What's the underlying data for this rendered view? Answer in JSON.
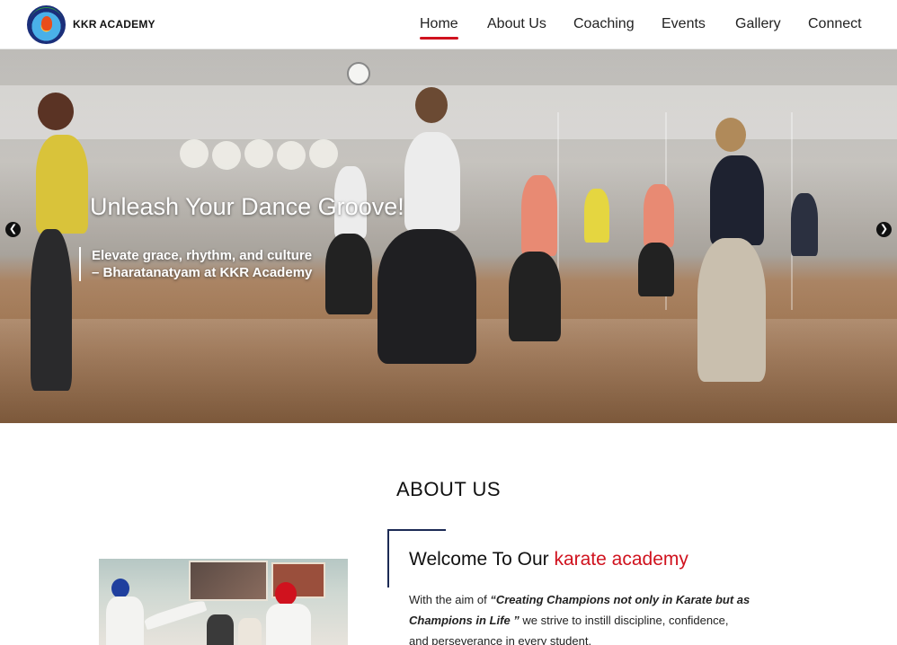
{
  "header": {
    "brand": "KKR ACADEMY",
    "logo_icon": "academy-logo",
    "nav": [
      {
        "label": "Home",
        "active": true
      },
      {
        "label": "About Us",
        "active": false
      },
      {
        "label": "Coaching",
        "active": false
      },
      {
        "label": "Events",
        "active": false
      },
      {
        "label": "Gallery",
        "active": false
      },
      {
        "label": "Connect",
        "active": false
      }
    ]
  },
  "hero": {
    "title": "Unleash Your Dance Groove!",
    "subtitle": "Elevate grace, rhythm, and culture – Bharatanatyam at KKR Academy",
    "prev_icon": "chevron-left-icon",
    "next_icon": "chevron-right-icon",
    "prev_glyph": "❮",
    "next_glyph": "❯"
  },
  "about": {
    "heading": "ABOUT US",
    "welcome_prefix": "Welcome To Our ",
    "welcome_accent": "karate academy",
    "body_lead": "With the aim of ",
    "body_quote": "“Creating Champions not only in Karate but as Champions in Life ”",
    "body_rest": " we strive to instill discipline, confidence, and perseverance in every student."
  },
  "colors": {
    "accent": "#d0121e",
    "frame": "#1c2a55"
  }
}
